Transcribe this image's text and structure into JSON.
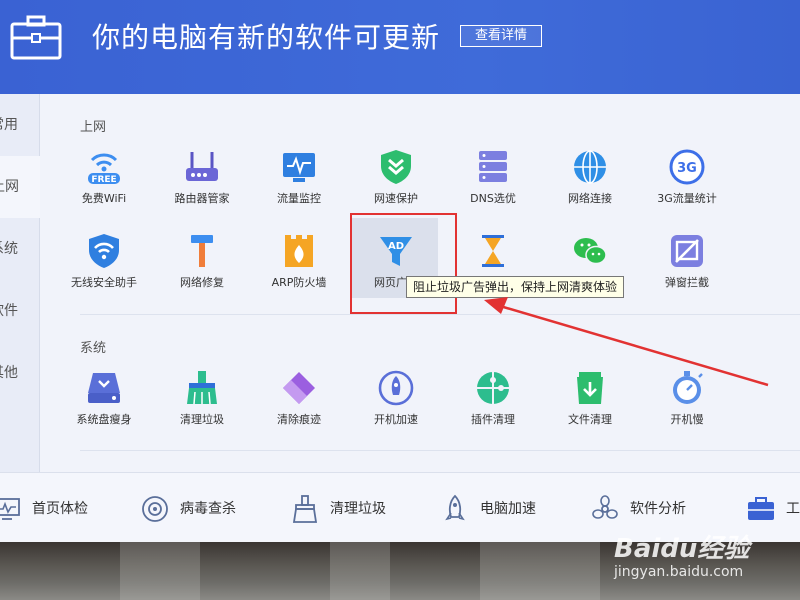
{
  "header": {
    "title": "你的电脑有新的软件可更新",
    "detail_button": "查看详情"
  },
  "sidebar": {
    "items": [
      {
        "label": "常用"
      },
      {
        "label": "上网"
      },
      {
        "label": "系统"
      },
      {
        "label": "软件"
      },
      {
        "label": "其他"
      }
    ],
    "active": "上网"
  },
  "sections": [
    {
      "title": "上网",
      "tools": [
        {
          "label": "免费WiFi",
          "icon": "free-wifi-icon"
        },
        {
          "label": "路由器管家",
          "icon": "router-icon"
        },
        {
          "label": "流量监控",
          "icon": "traffic-monitor-icon"
        },
        {
          "label": "网速保护",
          "icon": "speed-shield-icon"
        },
        {
          "label": "DNS选优",
          "icon": "dns-server-icon"
        },
        {
          "label": "网络连接",
          "icon": "globe-icon"
        },
        {
          "label": "3G流量统计",
          "icon": "3g-icon"
        },
        {
          "label": "无线安全助手",
          "icon": "wifi-shield-icon"
        },
        {
          "label": "网络修复",
          "icon": "hammer-icon"
        },
        {
          "label": "ARP防火墙",
          "icon": "firewall-icon"
        },
        {
          "label": "网页广告",
          "icon": "ad-filter-icon"
        },
        {
          "label": "",
          "icon": "hourglass-icon"
        },
        {
          "label": "",
          "icon": "wechat-icon"
        },
        {
          "label": "弹窗拦截",
          "icon": "popup-block-icon"
        }
      ]
    },
    {
      "title": "系统",
      "tools": [
        {
          "label": "系统盘瘦身",
          "icon": "disk-slim-icon"
        },
        {
          "label": "清理垃圾",
          "icon": "broom-icon"
        },
        {
          "label": "清除痕迹",
          "icon": "eraser-icon"
        },
        {
          "label": "开机加速",
          "icon": "rocket-icon"
        },
        {
          "label": "插件清理",
          "icon": "puzzle-icon"
        },
        {
          "label": "文件清理",
          "icon": "file-clean-icon"
        },
        {
          "label": "开机慢",
          "icon": "stopwatch-icon"
        }
      ]
    }
  ],
  "tooltip": "阻止垃圾广告弹出，保持上网清爽体验",
  "bottom_nav": [
    {
      "label": "首页体检",
      "icon": "monitor-icon"
    },
    {
      "label": "病毒查杀",
      "icon": "virus-scan-icon"
    },
    {
      "label": "清理垃圾",
      "icon": "broom-icon"
    },
    {
      "label": "电脑加速",
      "icon": "rocket-icon"
    },
    {
      "label": "软件分析",
      "icon": "software-analysis-icon"
    },
    {
      "label": "工",
      "icon": "toolbox-icon"
    }
  ],
  "watermark": {
    "main": "Baidu经验",
    "sub": "jingyan.baidu.com"
  },
  "colors": {
    "header": "#3f6bd9",
    "accent_red": "#e23232",
    "icon_blue": "#3d8ef0"
  }
}
